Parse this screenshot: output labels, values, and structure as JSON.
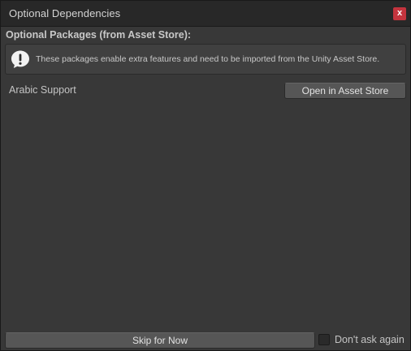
{
  "window": {
    "title": "Optional Dependencies",
    "close_label": "x"
  },
  "content": {
    "section_header": "Optional Packages (from Asset Store):",
    "help_text": "These packages enable extra features and need to be imported from the Unity Asset Store.",
    "packages": [
      {
        "name": "Arabic Support",
        "action_label": "Open in Asset Store"
      }
    ]
  },
  "footer": {
    "skip_label": "Skip for Now",
    "dont_ask_label": "Don't ask again",
    "dont_ask_checked": false
  },
  "icons": {
    "info": "info-icon",
    "close": "close-icon"
  },
  "colors": {
    "close_button": "#c4343e",
    "window_bg": "#383838",
    "titlebar_bg": "#282828"
  }
}
